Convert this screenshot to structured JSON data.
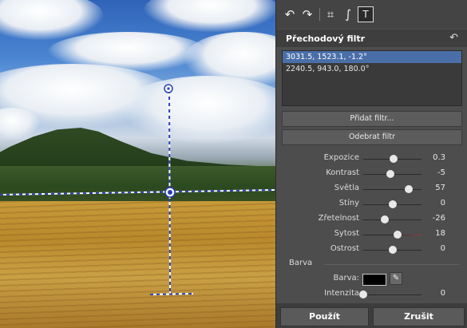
{
  "toolbar": {
    "tools": [
      {
        "icon": "rotate-left-icon",
        "glyph": "↶"
      },
      {
        "icon": "rotate-right-icon",
        "glyph": "↷"
      },
      {
        "icon": "crop-icon",
        "glyph": "⌗"
      },
      {
        "icon": "straighten-icon",
        "glyph": "∫"
      },
      {
        "icon": "gradient-filter-icon",
        "glyph": "T"
      }
    ]
  },
  "section": {
    "title": "Přechodový filtr",
    "undo_icon": "undo-icon"
  },
  "filter_list": {
    "items": [
      "3031.5, 1523.1, -1.2°",
      "2240.5, 943.0, 180.0°"
    ],
    "selected_index": 0
  },
  "buttons": {
    "add_filter": "Přidat filtr...",
    "remove_filter": "Odebrat filtr"
  },
  "sliders": [
    {
      "label": "Expozice",
      "value": "0.3",
      "fraction": 0.52,
      "tint": "neutral"
    },
    {
      "label": "Kontrast",
      "value": "-5",
      "fraction": 0.46,
      "tint": "neutral"
    },
    {
      "label": "Světla",
      "value": "57",
      "fraction": 0.78,
      "tint": "neutral"
    },
    {
      "label": "Stíny",
      "value": "0",
      "fraction": 0.5,
      "tint": "neutral"
    },
    {
      "label": "Zřetelnost",
      "value": "-26",
      "fraction": 0.37,
      "tint": "neutral"
    },
    {
      "label": "Sytost",
      "value": "18",
      "fraction": 0.59,
      "tint": "red"
    },
    {
      "label": "Ostrost",
      "value": "0",
      "fraction": 0.5,
      "tint": "neutral"
    }
  ],
  "color_group": {
    "title": "Barva",
    "color_label": "Barva:",
    "color_value": "#000000",
    "picker_icon": "eyedropper-icon",
    "intensity_label": "Intenzita",
    "intensity_value": "0",
    "intensity_fraction": 0.0
  },
  "footer": {
    "apply": "Použít",
    "cancel": "Zrušit"
  },
  "colors": {
    "selection": "#4a6fa8",
    "panel": "#4d4d4d",
    "guide": "#ffffff",
    "guide_dash": "#2b3fb0"
  }
}
